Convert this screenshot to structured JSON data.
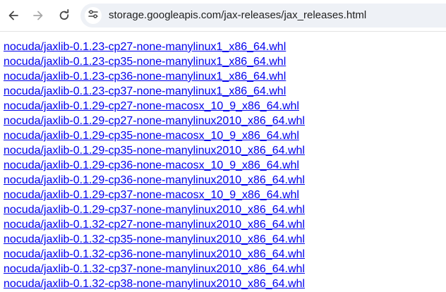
{
  "browser": {
    "url": "storage.googleapis.com/jax-releases/jax_releases.html",
    "icons": {
      "back": "back-arrow-icon",
      "forward": "forward-arrow-icon",
      "reload": "reload-icon",
      "site_info": "tune-icon"
    }
  },
  "colors": {
    "link": "#0000ee",
    "omnibox": "#eef1f6"
  },
  "links": [
    "nocuda/jaxlib-0.1.23-cp27-none-manylinux1_x86_64.whl",
    "nocuda/jaxlib-0.1.23-cp35-none-manylinux1_x86_64.whl",
    "nocuda/jaxlib-0.1.23-cp36-none-manylinux1_x86_64.whl",
    "nocuda/jaxlib-0.1.23-cp37-none-manylinux1_x86_64.whl",
    "nocuda/jaxlib-0.1.29-cp27-none-macosx_10_9_x86_64.whl",
    "nocuda/jaxlib-0.1.29-cp27-none-manylinux2010_x86_64.whl",
    "nocuda/jaxlib-0.1.29-cp35-none-macosx_10_9_x86_64.whl",
    "nocuda/jaxlib-0.1.29-cp35-none-manylinux2010_x86_64.whl",
    "nocuda/jaxlib-0.1.29-cp36-none-macosx_10_9_x86_64.whl",
    "nocuda/jaxlib-0.1.29-cp36-none-manylinux2010_x86_64.whl",
    "nocuda/jaxlib-0.1.29-cp37-none-macosx_10_9_x86_64.whl",
    "nocuda/jaxlib-0.1.29-cp37-none-manylinux2010_x86_64.whl",
    "nocuda/jaxlib-0.1.32-cp27-none-manylinux2010_x86_64.whl",
    "nocuda/jaxlib-0.1.32-cp35-none-manylinux2010_x86_64.whl",
    "nocuda/jaxlib-0.1.32-cp36-none-manylinux2010_x86_64.whl",
    "nocuda/jaxlib-0.1.32-cp37-none-manylinux2010_x86_64.whl",
    "nocuda/jaxlib-0.1.32-cp38-none-manylinux2010_x86_64.whl"
  ]
}
